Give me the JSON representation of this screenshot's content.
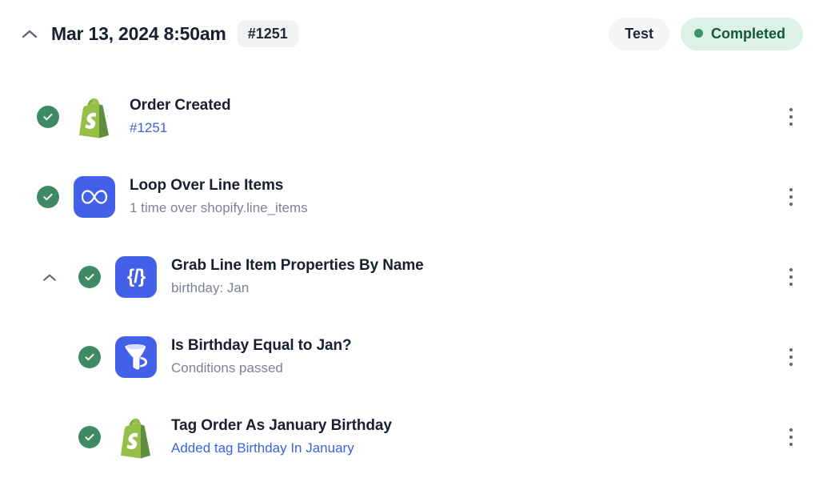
{
  "header": {
    "collapse_icon": "chevron-up-icon",
    "title": "Mar 13, 2024 8:50am",
    "run_id": "#1251",
    "environment_label": "Test",
    "status_label": "Completed",
    "status_icon": "status-dot-icon"
  },
  "colors": {
    "success_green": "#3d8a64",
    "status_pill_bg": "#ddf2e5",
    "status_pill_text": "#14563c",
    "app_tile_blue": "#4361e8",
    "link_blue": "#3c62e0",
    "muted_text": "#7b8494",
    "badge_bg": "#f1f2f4",
    "shopify_light": "#95bf47",
    "shopify_dark": "#5e8e3e"
  },
  "steps": [
    {
      "status": "success",
      "status_icon": "check-circle-icon",
      "icon": "shopify-icon",
      "icon_type": "shopify",
      "title": "Order Created",
      "subtitle": "#1251",
      "subtitle_style": "link",
      "depth": 0,
      "has_chevron": false,
      "menu_icon": "kebab-menu-icon"
    },
    {
      "status": "success",
      "status_icon": "check-circle-icon",
      "icon": "loop-infinity-icon",
      "icon_type": "tile",
      "title": "Loop Over Line Items",
      "subtitle": "1 time over shopify.line_items",
      "subtitle_style": "muted",
      "depth": 1,
      "has_chevron": false,
      "menu_icon": "kebab-menu-icon"
    },
    {
      "status": "success",
      "status_icon": "check-circle-icon",
      "icon": "code-braces-icon",
      "icon_type": "tile",
      "title": "Grab Line Item Properties By Name",
      "subtitle": "birthday: Jan",
      "subtitle_style": "muted",
      "depth": 2,
      "has_chevron": true,
      "chevron_icon": "chevron-up-icon",
      "menu_icon": "kebab-menu-icon"
    },
    {
      "status": "success",
      "status_icon": "check-circle-icon",
      "icon": "filter-funnel-icon",
      "icon_type": "tile",
      "title": "Is Birthday Equal to Jan?",
      "subtitle": "Conditions passed",
      "subtitle_style": "muted",
      "depth": 2,
      "has_chevron": false,
      "menu_icon": "kebab-menu-icon"
    },
    {
      "status": "success",
      "status_icon": "check-circle-icon",
      "icon": "shopify-icon",
      "icon_type": "shopify",
      "title": "Tag Order As January Birthday",
      "subtitle": "Added tag Birthday In January",
      "subtitle_style": "link",
      "depth": 2,
      "has_chevron": false,
      "menu_icon": "kebab-menu-icon"
    }
  ]
}
